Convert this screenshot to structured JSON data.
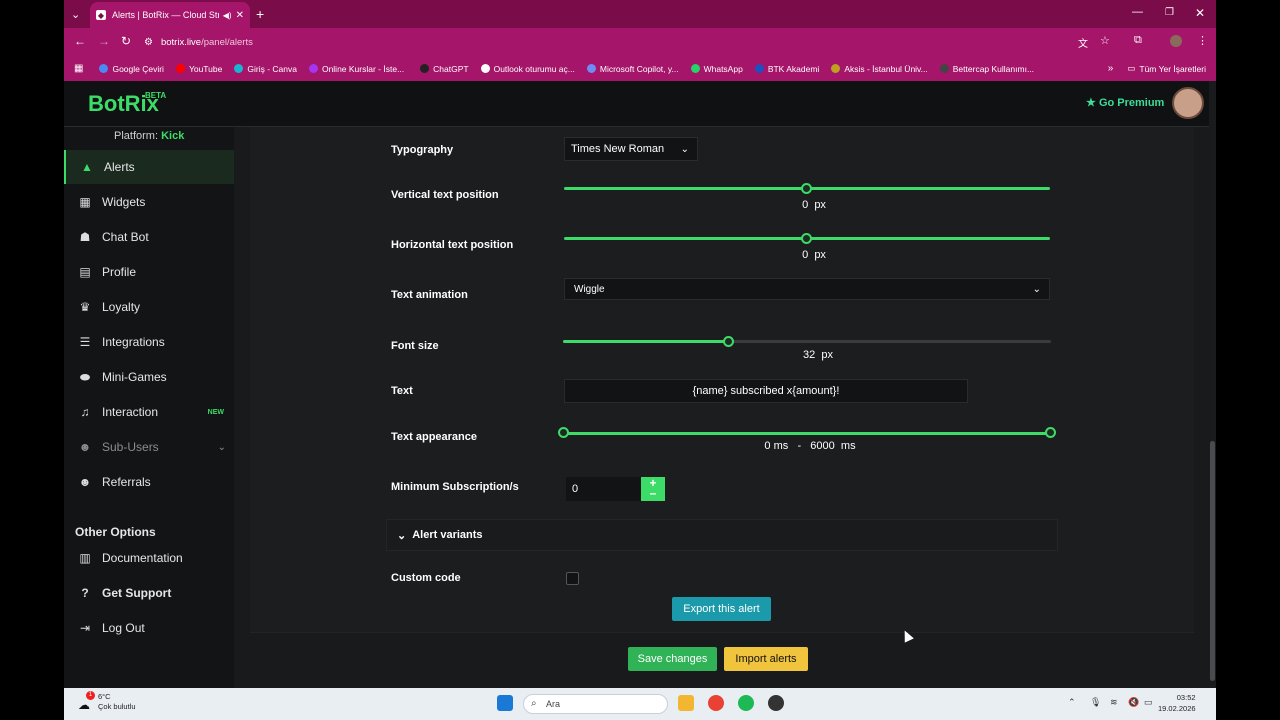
{
  "browser": {
    "tab_title": "Alerts | BotRix — Cloud Str...",
    "url_host": "botrix.live",
    "url_path": "/panel/alerts",
    "accent": "#a5156a",
    "bookmarks": [
      {
        "label": "Google Çeviri",
        "color": "#4a8af4"
      },
      {
        "label": "YouTube",
        "color": "#ff0000"
      },
      {
        "label": "Giriş - Canva",
        "color": "#18b7d0"
      },
      {
        "label": "Online Kurslar - İste...",
        "color": "#a435f0"
      },
      {
        "label": "ChatGPT",
        "color": "#222222"
      },
      {
        "label": "Outlook oturumu aç...",
        "color": "#ffffff"
      },
      {
        "label": "Microsoft Copilot, y...",
        "color": "#6f8bf5"
      },
      {
        "label": "WhatsApp",
        "color": "#25d366"
      },
      {
        "label": "BTK Akademi",
        "color": "#2050c0"
      },
      {
        "label": "Aksis - İstanbul Üniv...",
        "color": "#c0a020"
      },
      {
        "label": "Bettercap Kullanımı...",
        "color": "#444444"
      }
    ],
    "all_bookmarks": "Tüm Yer İşaretleri"
  },
  "header": {
    "logo": "BotRix",
    "logo_badge": "BETA",
    "premium": "Go Premium"
  },
  "sidebar": {
    "platform_label": "Platform:",
    "platform_value": "Kick",
    "items": [
      {
        "label": "Alerts",
        "icon": "alert-triangle-icon"
      },
      {
        "label": "Widgets",
        "icon": "grid-icon"
      },
      {
        "label": "Chat Bot",
        "icon": "robot-icon"
      },
      {
        "label": "Profile",
        "icon": "id-card-icon"
      },
      {
        "label": "Loyalty",
        "icon": "trophy-icon"
      },
      {
        "label": "Integrations",
        "icon": "list-icon"
      },
      {
        "label": "Mini-Games",
        "icon": "gamepad-icon"
      },
      {
        "label": "Interaction",
        "icon": "music-icon",
        "badge": "NEW"
      },
      {
        "label": "Sub-Users",
        "icon": "users-icon"
      },
      {
        "label": "Referrals",
        "icon": "people-icon"
      }
    ],
    "other_heading": "Other Options",
    "other_items": [
      {
        "label": "Documentation",
        "icon": "book-icon"
      },
      {
        "label": "Get Support",
        "icon": "question-icon"
      },
      {
        "label": "Log Out",
        "icon": "logout-icon"
      }
    ]
  },
  "form": {
    "typography_label": "Typography",
    "typography_value": "Times New Roman",
    "vertical_label": "Vertical text position",
    "vertical_value": "0",
    "vertical_unit": "px",
    "horizontal_label": "Horizontal text position",
    "horizontal_value": "0",
    "horizontal_unit": "px",
    "animation_label": "Text animation",
    "animation_value": "Wiggle",
    "fontsize_label": "Font size",
    "fontsize_value": "32",
    "fontsize_unit": "px",
    "fontsize_fraction": 0.34,
    "text_label": "Text",
    "text_value": "{name} subscribed x{amount}!",
    "appearance_label": "Text appearance",
    "appearance_min": "0",
    "appearance_sep": "-",
    "appearance_max": "6000",
    "appearance_unit": "ms",
    "minsub_label": "Minimum Subscription/s",
    "minsub_value": "0",
    "variants_label": "Alert variants",
    "custom_code_label": "Custom code"
  },
  "actions": {
    "export": "Export this alert",
    "save": "Save changes",
    "import": "Import alerts"
  },
  "taskbar": {
    "temp": "6°C",
    "weather": "Çok bulutlu",
    "badge": "1",
    "search": "Ara",
    "time": "03:52",
    "date": "19.02.2026"
  }
}
